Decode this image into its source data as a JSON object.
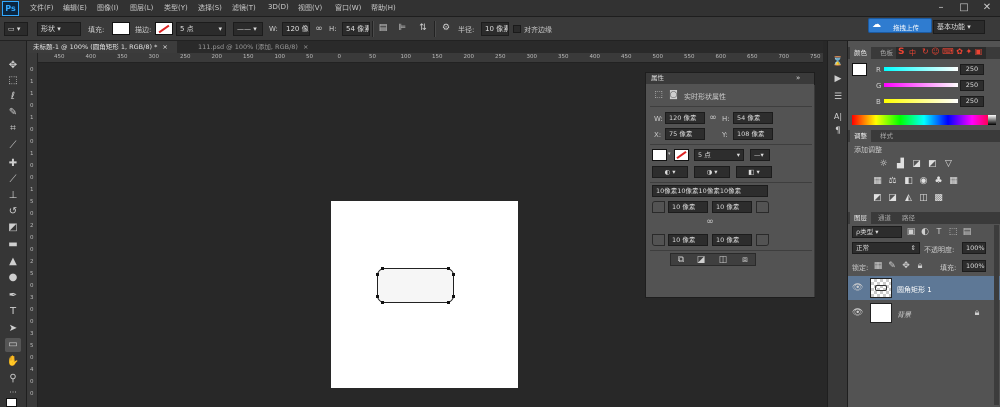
{
  "app": {
    "logo": "Ps"
  },
  "menu": [
    "文件(F)",
    "编辑(E)",
    "图像(I)",
    "图层(L)",
    "类型(Y)",
    "选择(S)",
    "滤镜(T)",
    "3D(D)",
    "视图(V)",
    "窗口(W)",
    "帮助(H)"
  ],
  "options": {
    "mode": "形状",
    "fill_label": "填充:",
    "stroke_label": "描边:",
    "stroke_width": "5 点",
    "w_label": "W:",
    "w_value": "120 像素",
    "h_label": "H:",
    "h_value": "54 像素",
    "radius_label": "半径:",
    "radius_value": "10 像素",
    "align_edges": "对齐边缘",
    "upload_button": "拖拽上传",
    "workspace": "基本功能"
  },
  "tabs": [
    {
      "label": "未标题-1 @ 100% (圆角矩形 1, RGB/8) *",
      "active": true
    },
    {
      "label": "111.psd @ 100% (添加, RGB/8)",
      "active": false
    }
  ],
  "ruler": {
    "h": [
      "450",
      "400",
      "350",
      "300",
      "250",
      "200",
      "150",
      "100",
      "50",
      "0",
      "50",
      "100",
      "150",
      "200",
      "250",
      "300",
      "350",
      "400",
      "450",
      "500",
      "550",
      "600",
      "650",
      "700",
      "750"
    ],
    "v": [
      "0",
      "1",
      "1",
      "0",
      "1",
      "0",
      "0",
      "1",
      "0",
      "0",
      "1",
      "5",
      "0",
      "2",
      "0",
      "0",
      "2",
      "5",
      "0",
      "3",
      "0",
      "0",
      "3",
      "5",
      "0",
      "4",
      "0",
      "0"
    ]
  },
  "properties": {
    "title": "属性",
    "subtitle": "实时形状属性",
    "w_label": "W:",
    "w_value": "120 像素",
    "h_label": "H:",
    "h_value": "54 像素",
    "x_label": "X:",
    "x_value": "75 像素",
    "y_label": "Y:",
    "y_value": "108 像素",
    "stroke_width": "5 点",
    "corners_summary": "10像素10像素10像素10像素",
    "corner_tl": "10 像素",
    "corner_tr": "10 像素",
    "corner_bl": "10 像素",
    "corner_br": "10 像素"
  },
  "color_panel": {
    "tabs": [
      "颜色",
      "色板"
    ],
    "r_label": "R",
    "r_value": "250",
    "g_label": "G",
    "g_value": "250",
    "b_label": "B",
    "b_value": "250",
    "ime_text": "中"
  },
  "adjust_panel": {
    "tabs": [
      "调整",
      "样式"
    ],
    "title": "添加调整"
  },
  "layers_panel": {
    "tabs": [
      "图层",
      "通道",
      "路径"
    ],
    "filter": "ρ类型",
    "blend_mode": "正常",
    "opacity_label": "不透明度:",
    "opacity_value": "100%",
    "lock_label": "锁定:",
    "fill_label": "填充:",
    "fill_value": "100%",
    "layers": [
      {
        "name": "圆角矩形 1",
        "selected": true
      },
      {
        "name": "背景",
        "selected": false
      }
    ]
  },
  "colors": {
    "accent": "#31a8ff",
    "panel": "#535353",
    "canvas_bg": "#282828",
    "selection": "#5e7896"
  }
}
